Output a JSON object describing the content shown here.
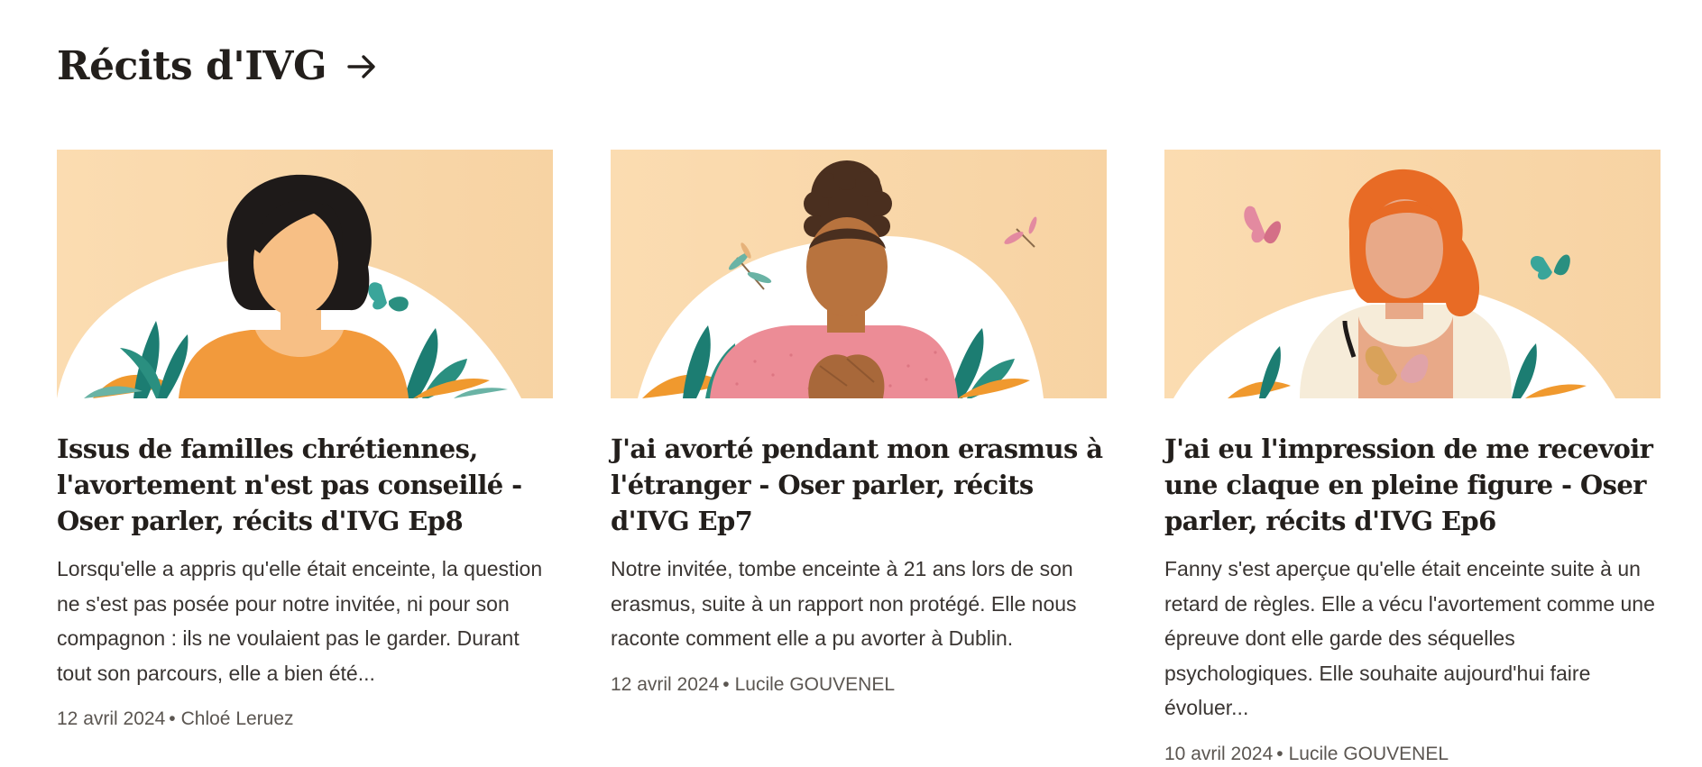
{
  "section": {
    "title": "Récits d'IVG",
    "arrow_icon": "arrow-right-icon"
  },
  "colors": {
    "background": "#ffffff",
    "thumb_background": "#f8d7a8",
    "text": "#231f1c",
    "meta": "#5b5651"
  },
  "cards": [
    {
      "title": "Issus de familles chrétiennes, l'avortement n'est pas conseillé - Oser parler, récits d'IVG Ep8",
      "excerpt": "Lorsqu'elle a appris qu'elle était enceinte, la question ne s'est pas posée pour notre invitée, ni pour son compagnon : ils ne voulaient pas le garder. Durant tout son parcours, elle a bien été...",
      "date": "12 avril 2024",
      "separator": "•",
      "author": "Chloé Leruez",
      "image": "illustration-woman-black-hair-orange-top"
    },
    {
      "title": "J'ai avorté pendant mon erasmus à l'étranger - Oser parler, récits d'IVG Ep7",
      "excerpt": "Notre invitée, tombe enceinte à 21 ans lors de son erasmus, suite à un rapport non protégé. Elle nous raconte comment elle a pu avorter à Dublin.",
      "date": "12 avril 2024",
      "separator": "•",
      "author": "Lucile GOUVENEL",
      "image": "illustration-woman-curly-hair-pink-sweater"
    },
    {
      "title": "J'ai eu l'impression de me recevoir une claque en pleine figure - Oser parler, récits d'IVG Ep6",
      "excerpt": "Fanny s'est aperçue qu'elle était enceinte suite à un retard de règles. Elle a vécu l'avortement comme une épreuve dont elle garde des séquelles psychologiques. Elle souhaite aujourd'hui faire évoluer...",
      "date": "10 avril 2024",
      "separator": "•",
      "author": "Lucile GOUVENEL",
      "image": "illustration-woman-red-hair-butterfly"
    }
  ]
}
